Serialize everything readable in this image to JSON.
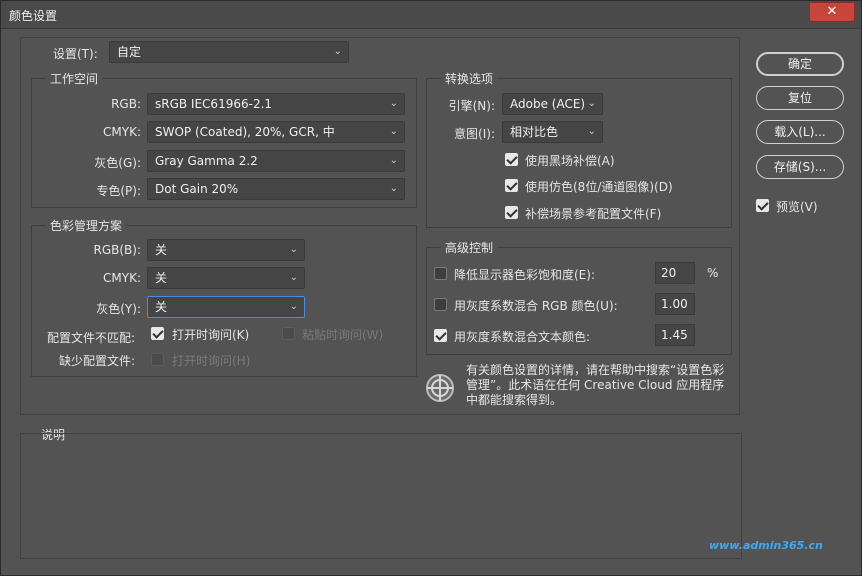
{
  "title": "颜色设置",
  "close_label": "✕",
  "settings": {
    "label": "设置(T):",
    "value": "自定"
  },
  "working_spaces": {
    "title": "工作空间",
    "rgb": {
      "label": "RGB:",
      "value": "sRGB IEC61966-2.1"
    },
    "cmyk": {
      "label": "CMYK:",
      "value": "SWOP (Coated), 20%, GCR, 中"
    },
    "gray": {
      "label": "灰色(G):",
      "value": "Gray Gamma 2.2"
    },
    "spot": {
      "label": "专色(P):",
      "value": "Dot Gain 20%"
    }
  },
  "policies": {
    "title": "色彩管理方案",
    "rgb": {
      "label": "RGB(B):",
      "value": "关"
    },
    "cmyk": {
      "label": "CMYK:",
      "value": "关"
    },
    "gray": {
      "label": "灰色(Y):",
      "value": "关"
    },
    "mismatch_label": "配置文件不匹配:",
    "ask_open": "打开时询问(K)",
    "ask_paste": "粘贴时询问(W)",
    "missing_label": "缺少配置文件:",
    "ask_open2": "打开时询问(H)"
  },
  "conversion": {
    "title": "转换选项",
    "engine": {
      "label": "引擎(N):",
      "value": "Adobe (ACE)"
    },
    "intent": {
      "label": "意图(I):",
      "value": "相对比色"
    },
    "black_point": "使用黑场补偿(A)",
    "dither": "使用仿色(8位/通道图像)(D)",
    "compensate": "补偿场景参考配置文件(F)"
  },
  "advanced": {
    "title": "高级控制",
    "desaturate": {
      "label": "降低显示器色彩饱和度(E):",
      "value": "20",
      "unit": "%"
    },
    "blend_rgb": {
      "label": "用灰度系数混合 RGB 颜色(U):",
      "value": "1.00"
    },
    "blend_text": {
      "label": "用灰度系数混合文本颜色:",
      "value": "1.45"
    }
  },
  "info_text": "有关颜色设置的详情，请在帮助中搜索“设置色彩管理”。此术语在任何 Creative Cloud 应用程序中都能搜索得到。",
  "buttons": {
    "ok": "确定",
    "reset": "复位",
    "load": "载入(L)...",
    "save": "存储(S)..."
  },
  "preview": "预览(V)",
  "description_title": "说明",
  "watermark": "www.admin365.cn"
}
